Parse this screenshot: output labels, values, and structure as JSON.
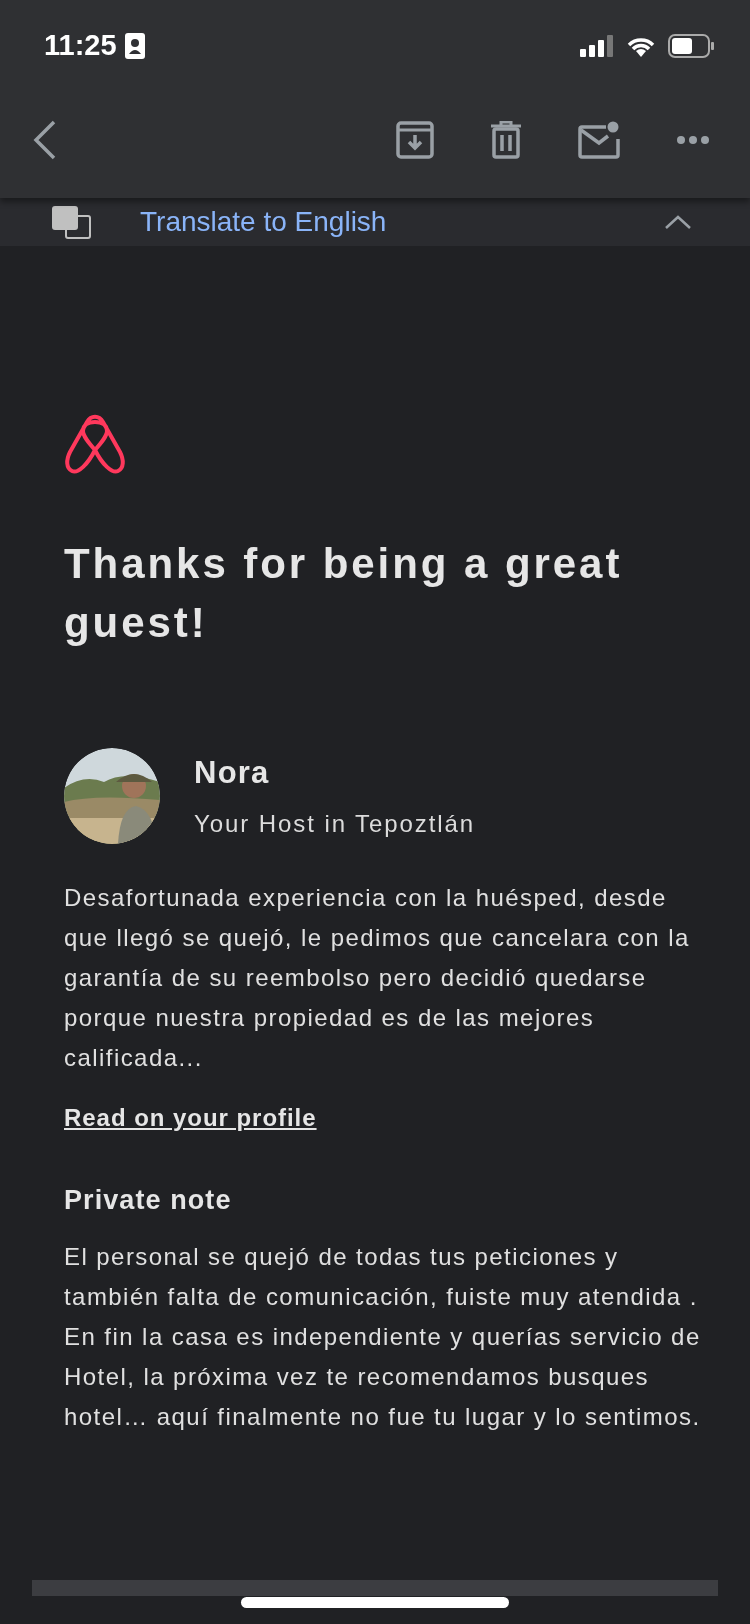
{
  "status_bar": {
    "time": "11:25"
  },
  "translate_bar": {
    "label": "Translate to English"
  },
  "email": {
    "title": "Thanks for being a great guest!",
    "host": {
      "name": "Nora",
      "subtitle": "Your Host in Tepoztlán"
    },
    "review": "Desafortunada experiencia con la huésped, desde que llegó se quejó, le pedimos que cancelara con la garantía de su reembolso pero decidió quedarse porque nuestra propiedad es de las mejores calificada...",
    "link": "Read on your profile",
    "private_note": {
      "heading": "Private note",
      "text": "El personal se quejó de todas tus peticiones y también falta de comunicación, fuiste muy atendida . En fin la casa es independiente y querías servicio de Hotel, la próxima vez te recomendamos busques hotel… aquí finalmente no fue tu lugar y lo sentimos."
    }
  }
}
